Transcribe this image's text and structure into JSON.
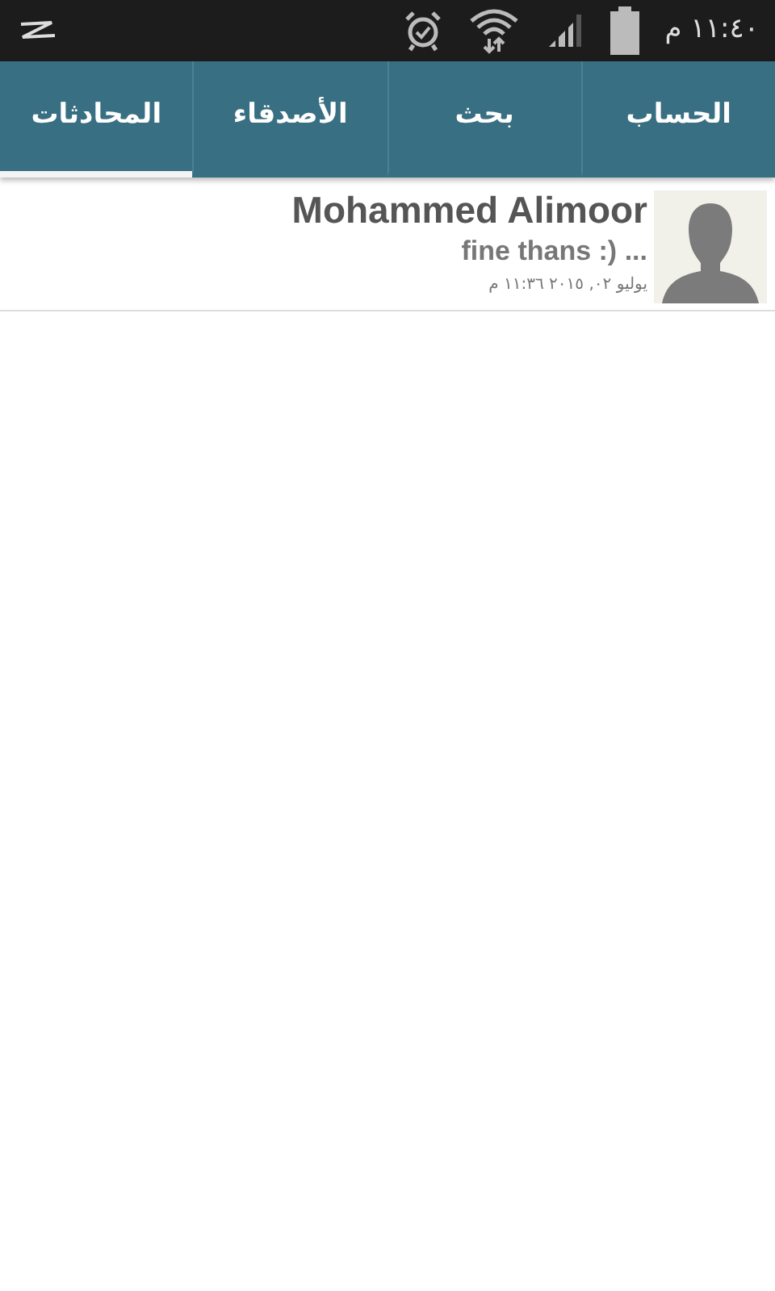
{
  "status_bar": {
    "time": "١١:٤٠ م"
  },
  "tabs": [
    {
      "label": "الحساب",
      "selected": false
    },
    {
      "label": "بحث",
      "selected": false
    },
    {
      "label": "الأصدقاء",
      "selected": false
    },
    {
      "label": "المحادثات",
      "selected": true
    }
  ],
  "conversations": [
    {
      "name": "Mohammed Alimoor",
      "preview": "fine thans :) ...",
      "date": "يوليو ٠٢, ٢٠١٥ ١١:٣٦ م"
    }
  ]
}
